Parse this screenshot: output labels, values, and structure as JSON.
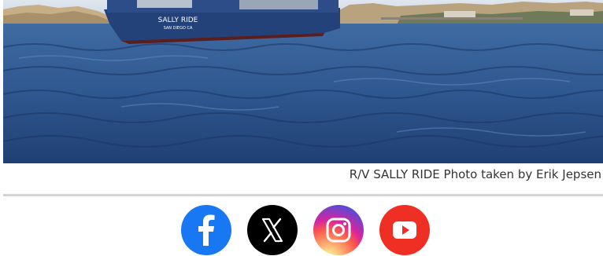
{
  "photo": {
    "alt": "R/V SALLY RIDE at sea off the coast",
    "ship_name": "SALLY RIDE",
    "ship_port": "SAN DIEGO CA"
  },
  "caption": "R/V SALLY RIDE Photo taken by Erik Jepsen",
  "social": {
    "facebook_label": "Facebook",
    "x_label": "X",
    "instagram_label": "Instagram",
    "youtube_label": "YouTube"
  },
  "colors": {
    "facebook": "#1877f2",
    "x": "#000000",
    "youtube": "#ef2e24",
    "divider": "#d4d4d4"
  }
}
